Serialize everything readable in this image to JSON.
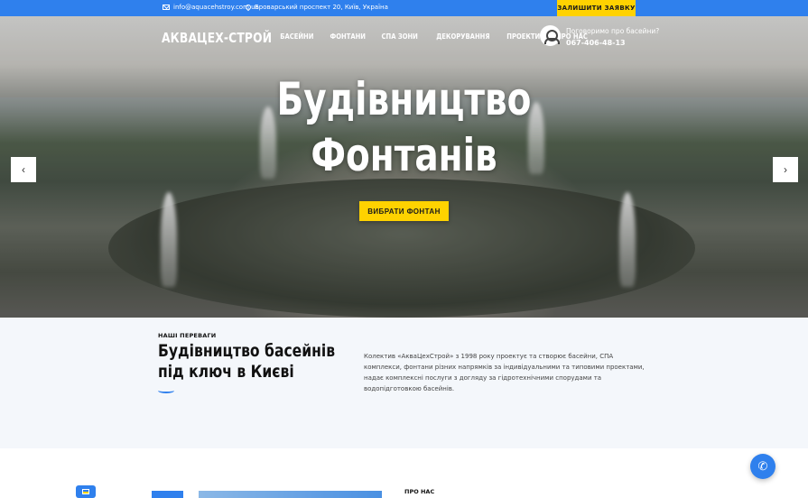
{
  "topbar": {
    "email": "info@aquacehstroy.com.ua",
    "address": "Броварський проспект 20, Київ, Україна",
    "cta": "ЗАЛИШИТИ ЗАЯВКУ"
  },
  "header": {
    "logo": "АКВАЦЕХ-СТРОЙ",
    "nav": [
      "БАСЕЙНИ",
      "ФОНТАНИ",
      "СПА ЗОНИ",
      "ДЕКОРУВАННЯ",
      "ПРОЕКТИ",
      "ПРО НАС"
    ],
    "consult_text": "Поговоримо про басейни?",
    "phone": "067-406-48-13"
  },
  "hero": {
    "title_line1": "Будівництво",
    "title_line2": "Фонтанів",
    "button": "ВИБРАТИ ФОНТАН",
    "prev_arrow": "‹",
    "next_arrow": "›"
  },
  "benefits": {
    "kicker": "НАШІ ПЕРЕВАГИ",
    "title": "Будівництво басейнів під ключ в Києві",
    "description": "Колектив «АкваЦехСтрой» з 1998 року проектує та створює басейни, СПА комплекси, фонтани різних напрямків за індивідуальними та типовими проектами, надає комплексні послуги з догляду за гідротехнічними спорудами та водопідготовкою басейнів."
  },
  "about": {
    "kicker": "ПРО НАС"
  },
  "colors": {
    "accent_blue": "#2f80ed",
    "accent_yellow": "#ffd200"
  },
  "icons": {
    "mail": "mail-icon",
    "pin": "location-pin-icon",
    "avatar": "support-avatar-icon",
    "phone": "phone-icon"
  }
}
